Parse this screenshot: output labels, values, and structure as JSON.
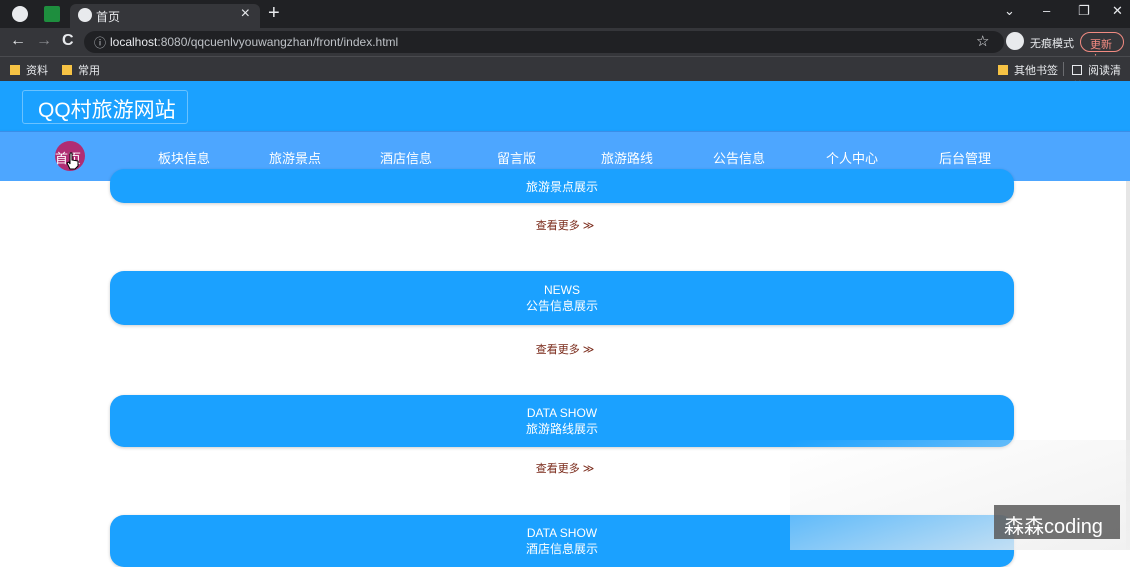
{
  "browser": {
    "tab_title": "首页",
    "tab_close": "×",
    "new_tab": "+",
    "window_controls": [
      "⌄",
      "–",
      "❐",
      "✕"
    ],
    "nav": {
      "back": "←",
      "forward": "→",
      "reload": "C"
    },
    "url_info_icon": "ⓘ",
    "url_host": "localhost",
    "url_rest": ":8080/qqcuenlvyouwangzhan/front/index.html",
    "star": "☆",
    "incognito_label": "无痕模式",
    "update_label": "更新 ⋮",
    "bookmarks": [
      "资料",
      "常用"
    ],
    "bookmarks_right": [
      "其他书签",
      "阅读清单"
    ]
  },
  "site": {
    "title": "QQ村旅游网站",
    "nav_items": [
      {
        "label": "首页"
      },
      {
        "label": "板块信息"
      },
      {
        "label": "旅游景点"
      },
      {
        "label": "酒店信息"
      },
      {
        "label": "留言版"
      },
      {
        "label": "旅游路线"
      },
      {
        "label": "公告信息"
      },
      {
        "label": "个人中心"
      },
      {
        "label": "后台管理"
      }
    ]
  },
  "sections": [
    {
      "en": "",
      "cn": "旅游景点展示",
      "more": "查看更多 ≫"
    },
    {
      "en": "NEWS",
      "cn": "公告信息展示",
      "more": "查看更多 ≫"
    },
    {
      "en": "DATA SHOW",
      "cn": "旅游路线展示",
      "more": "查看更多 ≫"
    },
    {
      "en": "DATA SHOW",
      "cn": "酒店信息展示",
      "more": ""
    }
  ],
  "watermark": "森森coding",
  "colors": {
    "header_blue": "#1ba1ff",
    "nav_blue": "#4da6ff",
    "more_link": "#7a2a1a"
  }
}
